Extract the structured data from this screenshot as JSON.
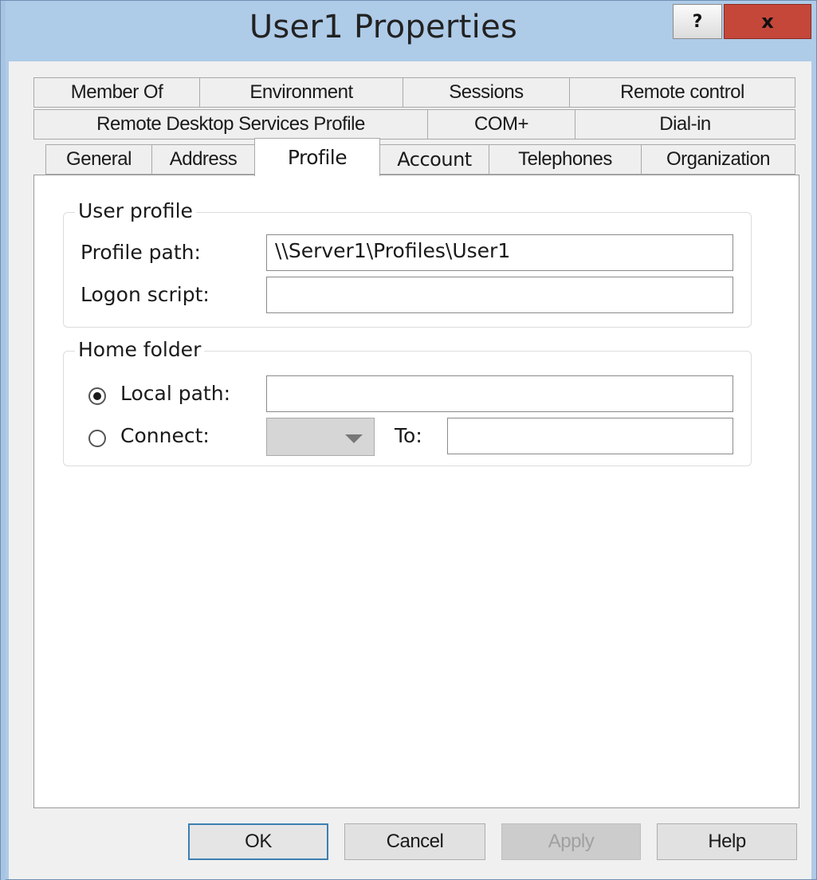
{
  "window": {
    "title": "User1 Properties",
    "help_label": "?",
    "close_label": "x"
  },
  "tabs": {
    "row1": [
      "Member Of",
      "Environment",
      "Sessions",
      "Remote control"
    ],
    "row2": [
      "Remote Desktop Services Profile",
      "COM+",
      "Dial-in"
    ],
    "row3": [
      "General",
      "Address",
      "Profile",
      "Account",
      "Telephones",
      "Organization"
    ],
    "active": "Profile"
  },
  "user_profile": {
    "legend": "User profile",
    "profile_path_label": "Profile path:",
    "profile_path_value": "\\\\Server1\\Profiles\\User1",
    "logon_script_label": "Logon script:",
    "logon_script_value": ""
  },
  "home_folder": {
    "legend": "Home folder",
    "local_path_label": "Local path:",
    "local_path_value": "",
    "local_path_selected": true,
    "connect_label": "Connect:",
    "connect_selected": false,
    "drive_value": "",
    "to_label": "To:",
    "to_value": ""
  },
  "buttons": {
    "ok": "OK",
    "cancel": "Cancel",
    "apply": "Apply",
    "help": "Help"
  },
  "colors": {
    "title_bar": "#aecbe8",
    "close_button": "#c4473a",
    "default_button_border": "#3c7fb1"
  },
  "icons": {
    "help": "question-mark",
    "close": "x-close",
    "dropdown": "triangle-down"
  }
}
